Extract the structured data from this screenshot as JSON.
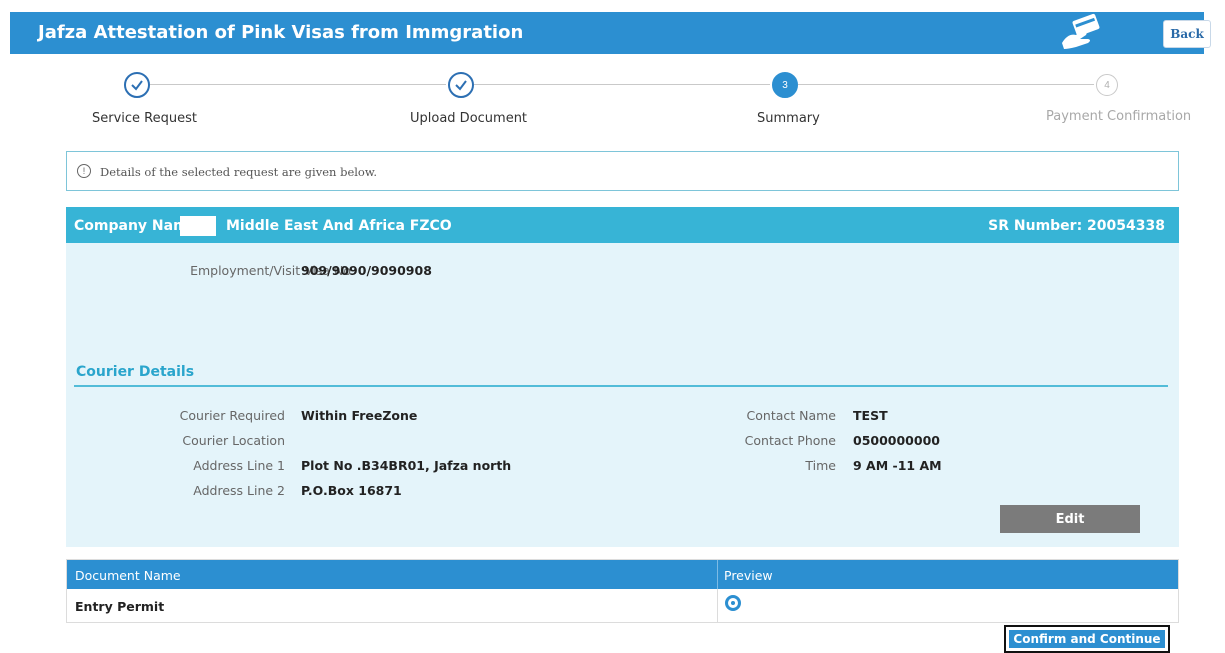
{
  "header": {
    "title": "Jafza Attestation of Pink Visas from Immgration",
    "icon": "card-payment-icon",
    "back_label": "Back",
    "color": "#2c8fd1"
  },
  "stepper": {
    "steps": [
      {
        "label": "Service Request",
        "state": "done",
        "number": ""
      },
      {
        "label": "Upload Document",
        "state": "done",
        "number": ""
      },
      {
        "label": "Summary",
        "state": "current",
        "number": "3"
      },
      {
        "label": "Payment Confirmation",
        "state": "pending",
        "number": "4"
      }
    ]
  },
  "info": {
    "text": "Details of the selected request are given below.",
    "icon_glyph": "!"
  },
  "summary": {
    "company_label": "Company Name:",
    "company_name": "Middle East And Africa FZCO",
    "sr_number": "SR Number: 20054338",
    "visa_label": "Employment/Visit Visa No",
    "visa_value": "909/9090/9090908",
    "panel_color": "#e4f4fa",
    "header_color": "#37b4d6"
  },
  "courier": {
    "title": "Courier Details",
    "left": [
      {
        "label": "Courier Required",
        "value": "Within FreeZone"
      },
      {
        "label": "Courier Location",
        "value": ""
      },
      {
        "label": "Address Line 1",
        "value": "Plot No .B34BR01, Jafza north"
      },
      {
        "label": "Address Line 2",
        "value": "P.O.Box 16871"
      }
    ],
    "right": [
      {
        "label": "Contact Name",
        "value": "TEST"
      },
      {
        "label": "Contact Phone",
        "value": "0500000000"
      },
      {
        "label": "Time",
        "value": "9 AM -11 AM"
      }
    ],
    "edit_label": "Edit"
  },
  "documents": {
    "headers": [
      "Document Name",
      "Preview"
    ],
    "rows": [
      {
        "name": "Entry Permit"
      }
    ]
  },
  "actions": {
    "confirm_label": "Confirm and Continue"
  }
}
